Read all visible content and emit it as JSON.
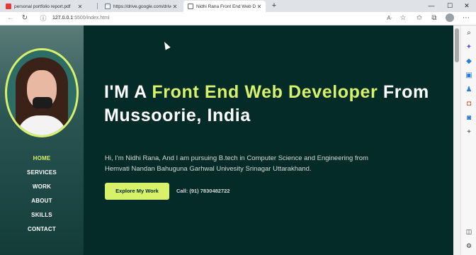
{
  "browser": {
    "tabs": [
      {
        "title": "personal portfolio report.pdf",
        "icon": "pdf-icon"
      },
      {
        "title": "https://drive.google.com/drive/...",
        "icon": "drive-icon"
      },
      {
        "title": "Nidhi Rana Front End Web Developer",
        "icon": "page-icon",
        "active": true
      }
    ],
    "new_tab": "+",
    "window_controls": {
      "minimize": "—",
      "maximize": "☐",
      "close": "✕"
    },
    "address": {
      "host": "127.0.0.1",
      "path": ":5500/index.html"
    }
  },
  "sidebar": {
    "nav": [
      "HOME",
      "SERVICES",
      "WORK",
      "ABOUT",
      "SKILLS",
      "CONTACT"
    ],
    "active_index": 0
  },
  "hero": {
    "headline_1": "I'M A ",
    "headline_hl": "Front End Web Developer",
    "headline_2": " From Mussoorie, India",
    "intro": "Hi, I'm Nidhi Rana, And I am pursuing B.tech in Computer Science and Engineering from Hemvati Nandan Bahuguna Garhwal Univesity Srinagar Uttarakhand.",
    "cta_label": "Explore My Work",
    "call_text": "Call: (91) 7830482722"
  },
  "colors": {
    "accent": "#d7f16b",
    "background": "#052b28",
    "sidebar": "#2a5552"
  }
}
